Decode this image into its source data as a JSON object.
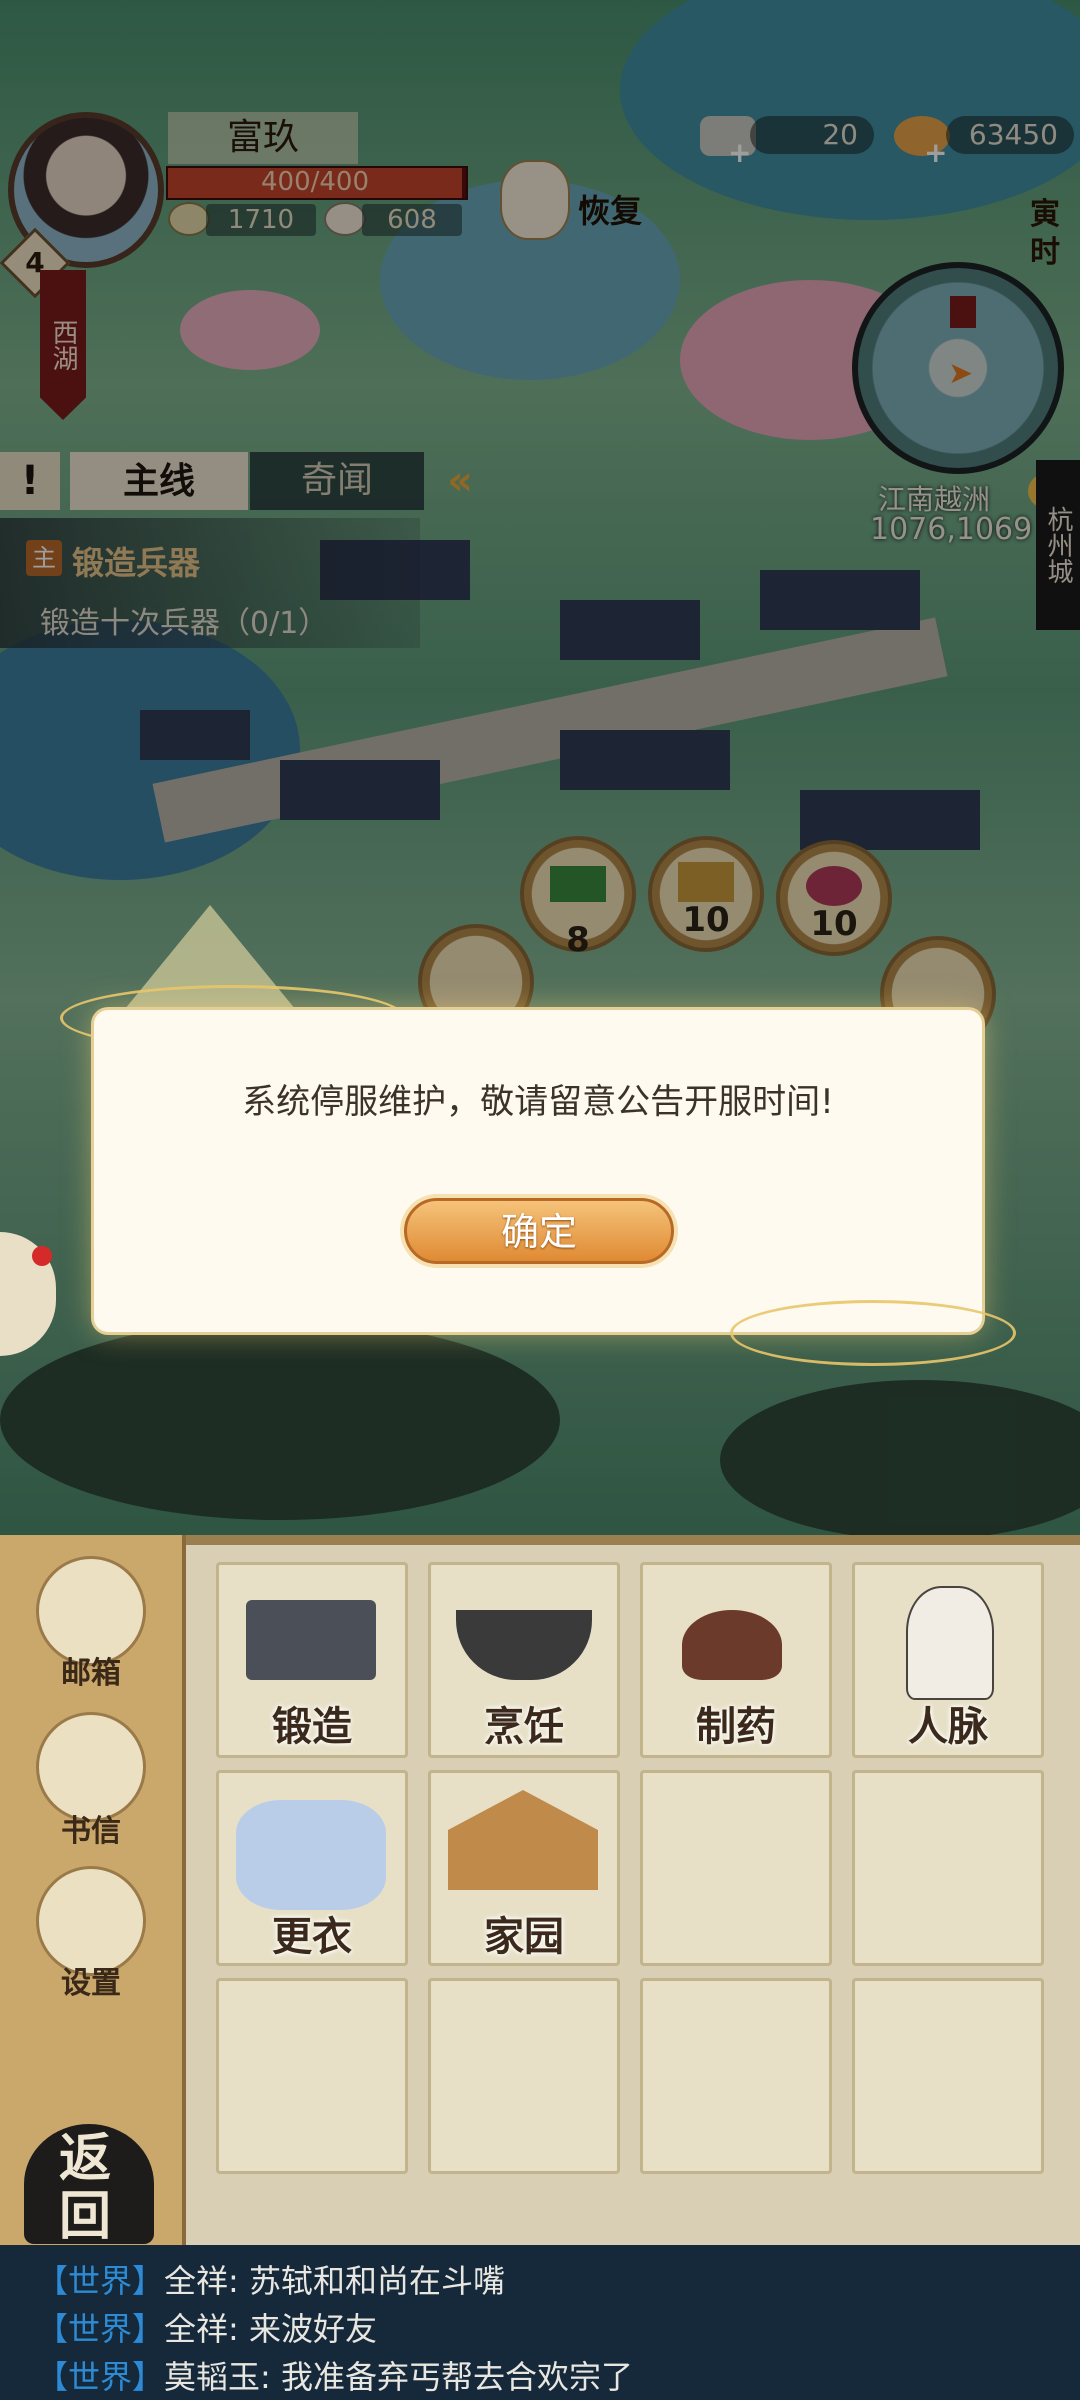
{
  "player": {
    "name": "富玖",
    "hp_text": "400/400",
    "hp_fraction": 1.0,
    "resource_a": "1710",
    "resource_b": "608",
    "level": "4",
    "location": "西湖"
  },
  "hud": {
    "recover_label": "恢复",
    "currency_silver": "20",
    "currency_coins": "63450",
    "shichen": "寅时",
    "region": "江南越洲",
    "coords": "1076,1069",
    "city": "杭州城"
  },
  "quest": {
    "alert_label": "!",
    "tab_main": "主线",
    "tab_side": "奇闻",
    "collapse_icon": "«",
    "badge": "主",
    "title": "锻造兵器",
    "description": "锻造十次兵器（0/1）"
  },
  "rewards": [
    {
      "icon": "jade-icon",
      "count": "8"
    },
    {
      "icon": "grain-icon",
      "count": "10"
    },
    {
      "icon": "flower-icon",
      "count": "10"
    }
  ],
  "modal": {
    "message": "系统停服维护，敬请留意公告开服时间!",
    "confirm_label": "确定"
  },
  "left_rail": [
    {
      "label": "邮箱",
      "icon": "mail-icon"
    },
    {
      "label": "书信",
      "icon": "letter-icon"
    },
    {
      "label": "设置",
      "icon": "gear-icon"
    }
  ],
  "back_label": "返回",
  "grid_items": [
    {
      "label": "锻造",
      "icon": "forge-icon"
    },
    {
      "label": "烹饪",
      "icon": "cooking-icon"
    },
    {
      "label": "制药",
      "icon": "medicine-icon"
    },
    {
      "label": "人脉",
      "icon": "contacts-icon"
    },
    {
      "label": "更衣",
      "icon": "clothing-icon"
    },
    {
      "label": "家园",
      "icon": "home-icon"
    }
  ],
  "chat": [
    {
      "channel": "【世界】",
      "text": "全祥: 苏轼和和尚在斗嘴"
    },
    {
      "channel": "【世界】",
      "text": "全祥: 来波好友"
    },
    {
      "channel": "【世界】",
      "text": "莫韬玉: 我准备弃丐帮去合欢宗了"
    }
  ],
  "colors": {
    "accent_orange": "#e08a33",
    "hp_red": "#c4442a",
    "chat_channel": "#2d8bd6"
  }
}
